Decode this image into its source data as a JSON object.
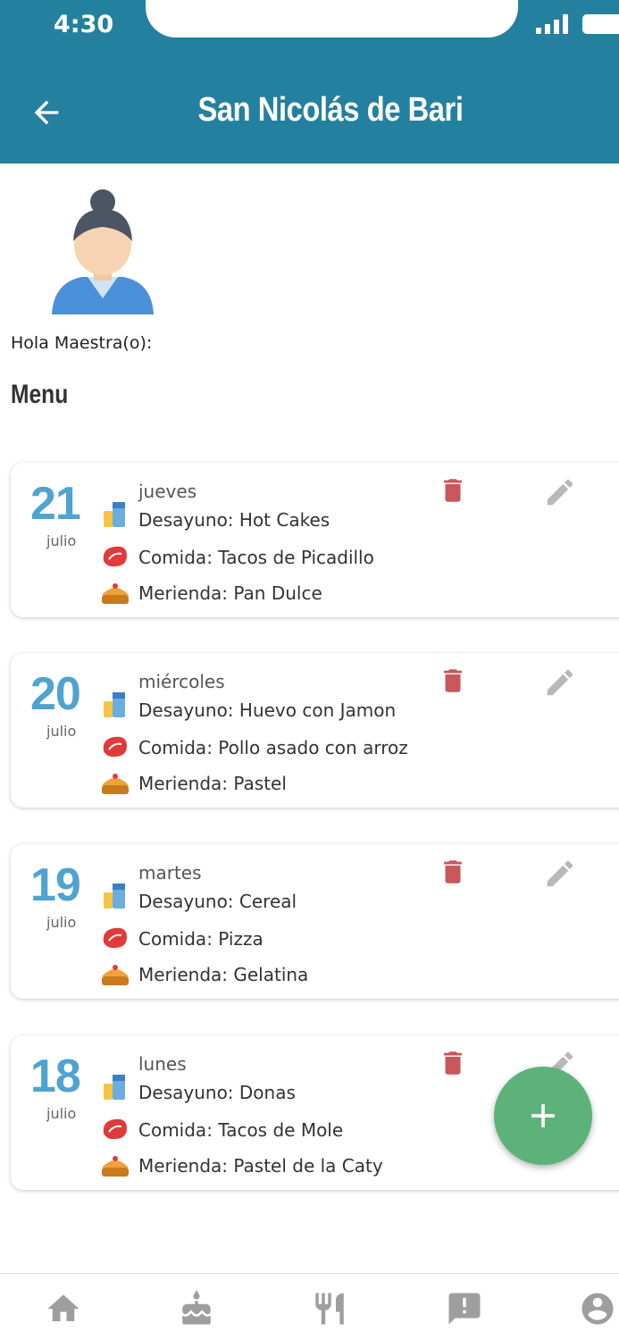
{
  "status_bar": {
    "time": "4:30"
  },
  "header": {
    "title": "San Nicolás de Bari",
    "back_icon": "arrow-left-icon"
  },
  "greeting": {
    "avatar_icon": "teacher-avatar-icon",
    "text": "Hola Maestra(o):"
  },
  "section": {
    "title": "Menu"
  },
  "menu_items": [
    {
      "day": "21",
      "month": "julio",
      "weekday": "jueves",
      "breakfast": "Desayuno: Hot Cakes",
      "lunch": "Comida: Tacos de Picadillo",
      "snack": "Merienda: Pan Dulce"
    },
    {
      "day": "20",
      "month": "julio",
      "weekday": "miércoles",
      "breakfast": "Desayuno: Huevo con Jamon",
      "lunch": "Comida: Pollo asado con arroz",
      "snack": "Merienda: Pastel"
    },
    {
      "day": "19",
      "month": "julio",
      "weekday": "martes",
      "breakfast": "Desayuno: Cereal",
      "lunch": "Comida: Pizza",
      "snack": "Merienda: Gelatina"
    },
    {
      "day": "18",
      "month": "julio",
      "weekday": "lunes",
      "breakfast": "Desayuno: Donas",
      "lunch": "Comida: Tacos de Mole",
      "snack": "Merienda: Pastel de la Caty"
    }
  ],
  "icons": {
    "breakfast": "milk-icon",
    "lunch": "steak-icon",
    "snack": "pie-icon",
    "delete": "trash-icon",
    "edit": "pencil-icon",
    "add": "plus-icon"
  },
  "colors": {
    "header": "#24809f",
    "date": "#4fa3d1",
    "delete": "#c9575b",
    "edit": "#b8b8b8",
    "fab": "#5db27a",
    "nav_icon": "#9e9e9e"
  },
  "bottom_nav": [
    "home-icon",
    "cake-icon",
    "utensils-icon",
    "alert-icon",
    "account-icon"
  ]
}
